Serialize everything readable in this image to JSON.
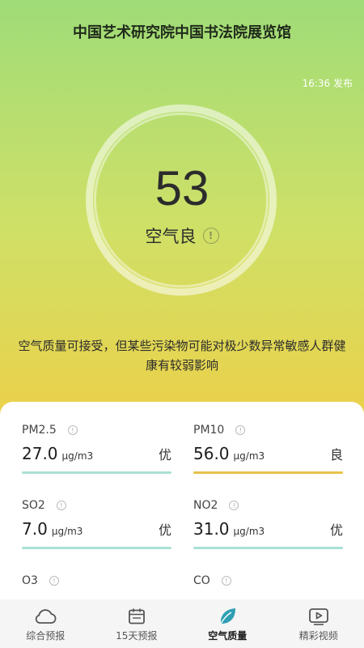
{
  "header": {
    "title": "中国艺术研究院中国书法院展览馆",
    "publish_time": "16:36 发布"
  },
  "aqi": {
    "value": "53",
    "level": "空气良",
    "info_symbol": "!",
    "description": "空气质量可接受，但某些污染物可能对极少数异常敏感人群健康有较弱影响"
  },
  "pollutants": [
    {
      "name": "PM2.5",
      "value": "27.0",
      "unit": "μg/m3",
      "grade": "优",
      "bar_color": "#a9e0d4"
    },
    {
      "name": "PM10",
      "value": "56.0",
      "unit": "μg/m3",
      "grade": "良",
      "bar_color": "#e8c24a"
    },
    {
      "name": "SO2",
      "value": "7.0",
      "unit": "μg/m3",
      "grade": "优",
      "bar_color": "#a9e0d4"
    },
    {
      "name": "NO2",
      "value": "31.0",
      "unit": "μg/m3",
      "grade": "优",
      "bar_color": "#a9e0d4"
    },
    {
      "name": "O3"
    },
    {
      "name": "CO"
    }
  ],
  "nav": {
    "items": [
      {
        "label": "综合预报",
        "icon": "cloud-icon"
      },
      {
        "label": "15天预报",
        "icon": "calendar-icon"
      },
      {
        "label": "空气质量",
        "icon": "leaf-icon",
        "active": true
      },
      {
        "label": "精彩视频",
        "icon": "video-icon"
      }
    ]
  },
  "colors": {
    "leaf_active": "#2f9fb3"
  }
}
